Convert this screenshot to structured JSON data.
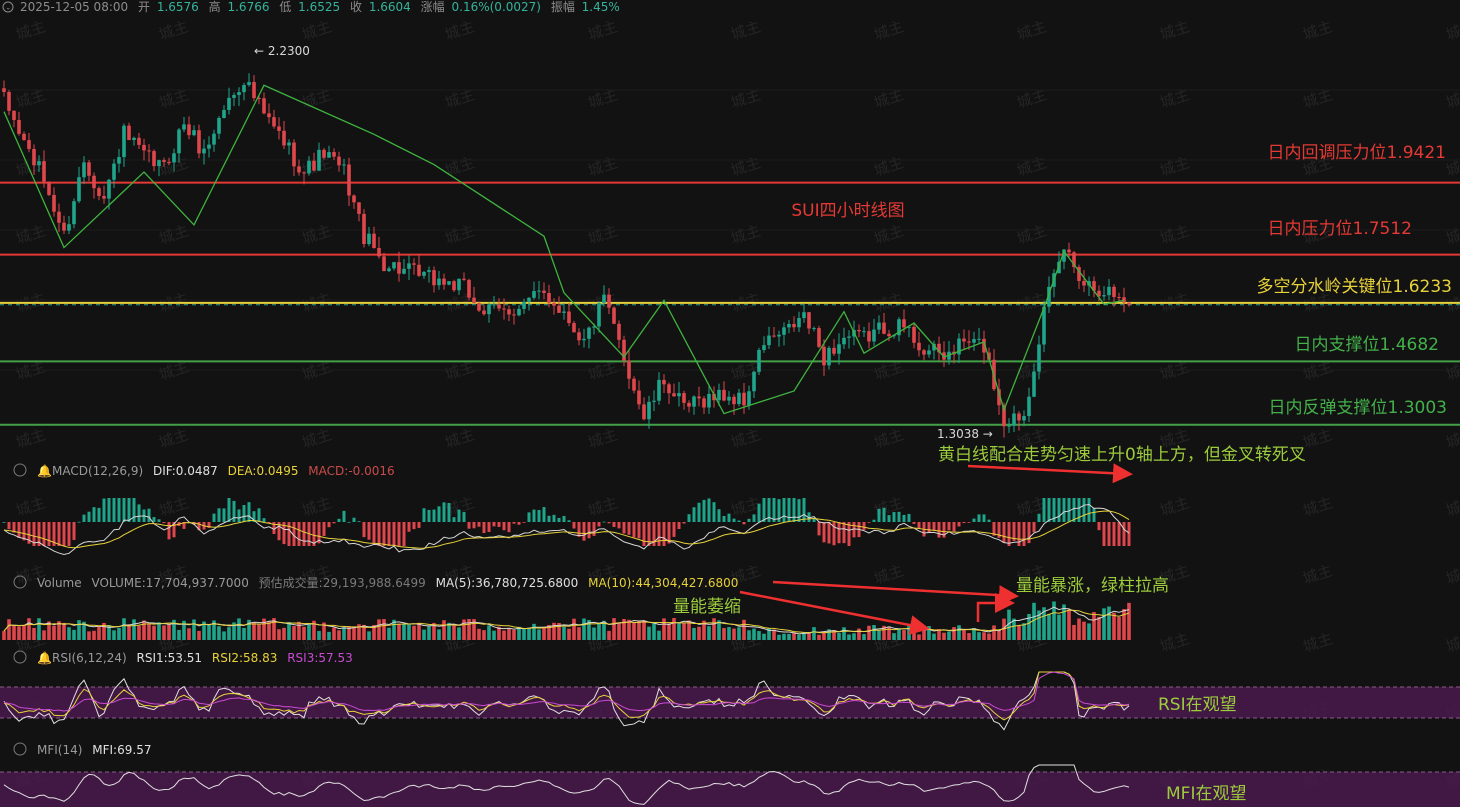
{
  "header": {
    "date": "2025-12-05 08:00",
    "open_label": "开",
    "open": "1.6576",
    "high_label": "高",
    "high": "1.6766",
    "low_label": "低",
    "low": "1.6525",
    "close_label": "收",
    "close": "1.6604",
    "change_label": "涨幅",
    "change": "0.16%(0.0027)",
    "amplitude_label": "振幅",
    "amplitude": "1.45%"
  },
  "watermark": "城主",
  "chart_title": "SUI四小时线图",
  "colors": {
    "background": "#121212",
    "up": "#1fa58c",
    "down": "#e0474c",
    "resistance": "#e53935",
    "key_level": "#e8d23a",
    "support": "#43a047",
    "wave": "#3fb33f",
    "annotation_green": "#9ccc3c",
    "arrow": "#ee3030",
    "rsi_band": "#4a1a4e"
  },
  "price_levels": [
    {
      "label": "日内回调压力位1.9421",
      "value": 1.9421,
      "kind": "resistance"
    },
    {
      "label": "日内压力位1.7512",
      "value": 1.7512,
      "kind": "resistance"
    },
    {
      "label": "多空分水岭关键位1.6233",
      "value": 1.6233,
      "kind": "key"
    },
    {
      "label": "日内支撑位1.4682",
      "value": 1.4682,
      "kind": "support"
    },
    {
      "label": "日内反弹支撑位1.3003",
      "value": 1.3003,
      "kind": "support"
    }
  ],
  "price_annotations": {
    "high_mark": "← 2.2300",
    "low_mark": "1.3038 →"
  },
  "macd": {
    "title": "MACD(12,26,9)",
    "dif_label": "DIF:",
    "dif": "0.0487",
    "dea_label": "DEA:",
    "dea": "0.0495",
    "macd_label": "MACD:",
    "macd": "-0.0016",
    "note": "黄白线配合走势匀速上升0轴上方，但金叉转死叉"
  },
  "volume": {
    "title": "Volume",
    "volume_label": "VOLUME:",
    "volume": "17,704,937.7000",
    "est_label": "预估成交量:",
    "est": "29,193,988.6499",
    "ma5_label": "MA(5):",
    "ma5": "36,780,725.6800",
    "ma10_label": "MA(10):",
    "ma10": "44,304,427.6800",
    "note_shrink": "量能萎缩",
    "note_surge": "量能暴涨，绿柱拉高"
  },
  "rsi": {
    "title": "RSI(6,12,24)",
    "rsi1_label": "RSI1:",
    "rsi1": "53.51",
    "rsi2_label": "RSI2:",
    "rsi2": "58.83",
    "rsi3_label": "RSI3:",
    "rsi3": "57.53",
    "note": "RSI在观望"
  },
  "mfi": {
    "title": "MFI(14)",
    "mfi_label": "MFI:",
    "mfi": "69.57",
    "note": "MFI在观望"
  },
  "chart_data": {
    "type": "candlestick",
    "title": "SUI四小时线图",
    "ylim": [
      1.26,
      2.32
    ],
    "price_path_anchors": [
      [
        0,
        2.16
      ],
      [
        4,
        2.05
      ],
      [
        8,
        1.95
      ],
      [
        12,
        1.8
      ],
      [
        16,
        2.0
      ],
      [
        20,
        1.9
      ],
      [
        24,
        2.07
      ],
      [
        28,
        2.01
      ],
      [
        32,
        1.98
      ],
      [
        36,
        2.1
      ],
      [
        40,
        2.02
      ],
      [
        44,
        2.14
      ],
      [
        48,
        2.22
      ],
      [
        52,
        2.12
      ],
      [
        56,
        2.05
      ],
      [
        60,
        1.97
      ],
      [
        64,
        2.02
      ],
      [
        68,
        1.97
      ],
      [
        72,
        1.8
      ],
      [
        76,
        1.73
      ],
      [
        80,
        1.71
      ],
      [
        84,
        1.69
      ],
      [
        88,
        1.68
      ],
      [
        92,
        1.66
      ],
      [
        96,
        1.6
      ],
      [
        100,
        1.6
      ],
      [
        104,
        1.62
      ],
      [
        108,
        1.65
      ],
      [
        112,
        1.6
      ],
      [
        116,
        1.52
      ],
      [
        120,
        1.63
      ],
      [
        124,
        1.48
      ],
      [
        128,
        1.32
      ],
      [
        132,
        1.42
      ],
      [
        136,
        1.34
      ],
      [
        140,
        1.37
      ],
      [
        144,
        1.38
      ],
      [
        148,
        1.36
      ],
      [
        152,
        1.52
      ],
      [
        156,
        1.54
      ],
      [
        160,
        1.59
      ],
      [
        164,
        1.48
      ],
      [
        168,
        1.53
      ],
      [
        172,
        1.53
      ],
      [
        176,
        1.56
      ],
      [
        180,
        1.56
      ],
      [
        184,
        1.5
      ],
      [
        188,
        1.48
      ],
      [
        192,
        1.52
      ],
      [
        196,
        1.51
      ],
      [
        200,
        1.31
      ],
      [
        204,
        1.33
      ],
      [
        208,
        1.6
      ],
      [
        212,
        1.77
      ],
      [
        216,
        1.68
      ],
      [
        220,
        1.66
      ],
      [
        224,
        1.63
      ]
    ],
    "candle_count": 226,
    "zigzag": [
      [
        0,
        2.13
      ],
      [
        12,
        1.77
      ],
      [
        28,
        1.97
      ],
      [
        38,
        1.83
      ],
      [
        52,
        2.2
      ],
      [
        74,
        2.07
      ],
      [
        86,
        1.99
      ],
      [
        108,
        1.8
      ],
      [
        112,
        1.65
      ],
      [
        124,
        1.48
      ],
      [
        132,
        1.63
      ],
      [
        144,
        1.33
      ],
      [
        158,
        1.39
      ],
      [
        168,
        1.6
      ],
      [
        172,
        1.49
      ],
      [
        182,
        1.57
      ],
      [
        188,
        1.48
      ],
      [
        196,
        1.52
      ],
      [
        200,
        1.34
      ],
      [
        208,
        1.61
      ],
      [
        212,
        1.76
      ],
      [
        220,
        1.62
      ],
      [
        224,
        1.63
      ]
    ],
    "high": {
      "value": 2.23,
      "index": 52
    },
    "low": {
      "value": 1.3038,
      "index": 201
    }
  }
}
